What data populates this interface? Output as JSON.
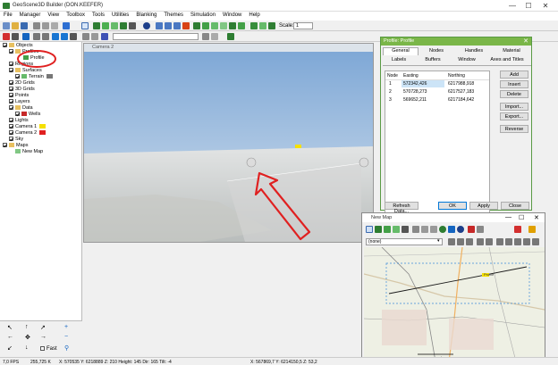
{
  "app": {
    "title": "GeoScene3D Builder (DON.KEEFER)",
    "controls": {
      "minimize": "—",
      "maximize": "☐",
      "close": "✕"
    }
  },
  "menu": [
    "File",
    "Manager",
    "View",
    "Toolbox",
    "Tools",
    "Utilities",
    "Blanking",
    "Themes",
    "Simulation",
    "Window",
    "Help"
  ],
  "toolbar": {
    "scale_label": "Scale:",
    "scale_value": "1"
  },
  "tree": {
    "items": [
      {
        "label": "Objects",
        "indent": 0
      },
      {
        "label": "Profiles",
        "indent": 1
      },
      {
        "label": "Profile",
        "indent": 2
      },
      {
        "label": "Regions",
        "indent": 1
      },
      {
        "label": "Surfaces",
        "indent": 1
      },
      {
        "label": "Terrain",
        "indent": 2
      },
      {
        "label": "2D Grids",
        "indent": 1
      },
      {
        "label": "3D Grids",
        "indent": 1
      },
      {
        "label": "Points",
        "indent": 1
      },
      {
        "label": "Layers",
        "indent": 1
      },
      {
        "label": "Data",
        "indent": 1
      },
      {
        "label": "Wells",
        "indent": 2
      },
      {
        "label": "Lights",
        "indent": 1
      },
      {
        "label": "Camera 1",
        "indent": 1
      },
      {
        "label": "Camera 2",
        "indent": 1
      },
      {
        "label": "Sky",
        "indent": 1
      },
      {
        "label": "Maps",
        "indent": 0
      },
      {
        "label": "New Map",
        "indent": 1
      }
    ]
  },
  "nav": {
    "fast_label": "Fast"
  },
  "camera_window": {
    "title": "Camera 2"
  },
  "profile_dialog": {
    "title": "Profile: Profile",
    "tabs_row1": [
      "General",
      "Nodes",
      "Handles",
      "Material"
    ],
    "tabs_row2": [
      "Labels",
      "Buffers",
      "Window",
      "Axes and Titles"
    ],
    "columns": [
      "Node",
      "Easting",
      "Northing"
    ],
    "rows": [
      {
        "node": "1",
        "easting": "572342,426",
        "northing": "6217988,918"
      },
      {
        "node": "2",
        "easting": "570728,273",
        "northing": "6217527,183"
      },
      {
        "node": "3",
        "easting": "569652,211",
        "northing": "6217184,642"
      }
    ],
    "side_buttons": [
      "Add",
      "Insert",
      "Delete",
      "Import...",
      "Export...",
      "Reverse"
    ],
    "bottom_buttons": {
      "refresh": "Refresh Data...",
      "ok": "OK",
      "apply": "Apply",
      "close": "Close"
    }
  },
  "map_window": {
    "title": "New Map",
    "dropdown_value": "(none)",
    "profile_label": "Profile",
    "scale_labels": [
      "0,5",
      "1,0",
      "km"
    ]
  },
  "status": {
    "fps": "7,0 FPS",
    "zoom": "255,725 K",
    "coords": "X: 570535  Y: 6218889  Z: 210  Height: 145  Dir: 165  Tilt: -4",
    "map_coords": "X: 567869,7  Y: 6214150,5  Z: 53,2"
  },
  "colors": {
    "accent": "#7ab648",
    "annotation": "#e02020"
  }
}
